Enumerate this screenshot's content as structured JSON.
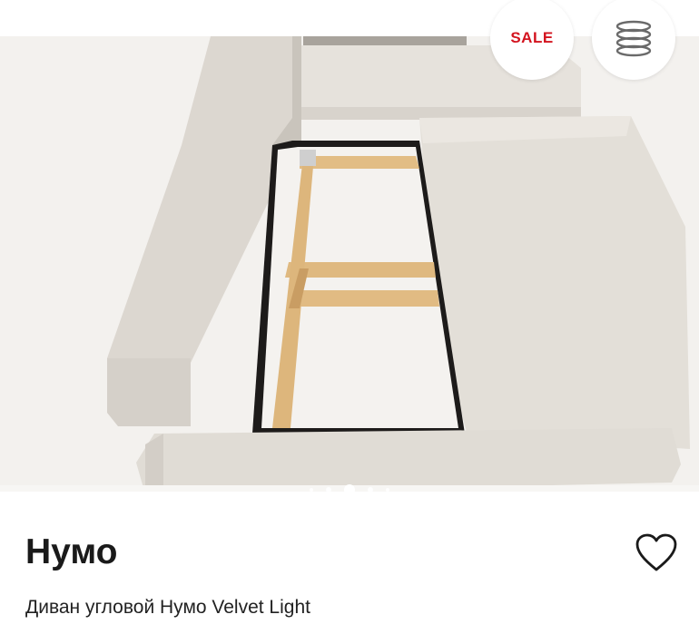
{
  "badges": {
    "sale": "SALE",
    "mechanism_icon": "spring-mechanism-icon"
  },
  "gallery": {
    "slide_count": 5,
    "active_slide": 3
  },
  "product": {
    "name": "Нумо",
    "description": "Диван угловой Нумо Velvet Light",
    "favorite_icon": "heart-outline-icon"
  },
  "colors": {
    "sale": "#d3141f",
    "text": "#1a1a1a",
    "upholstery": "#e4e0da",
    "wood": "#e0bc84"
  }
}
